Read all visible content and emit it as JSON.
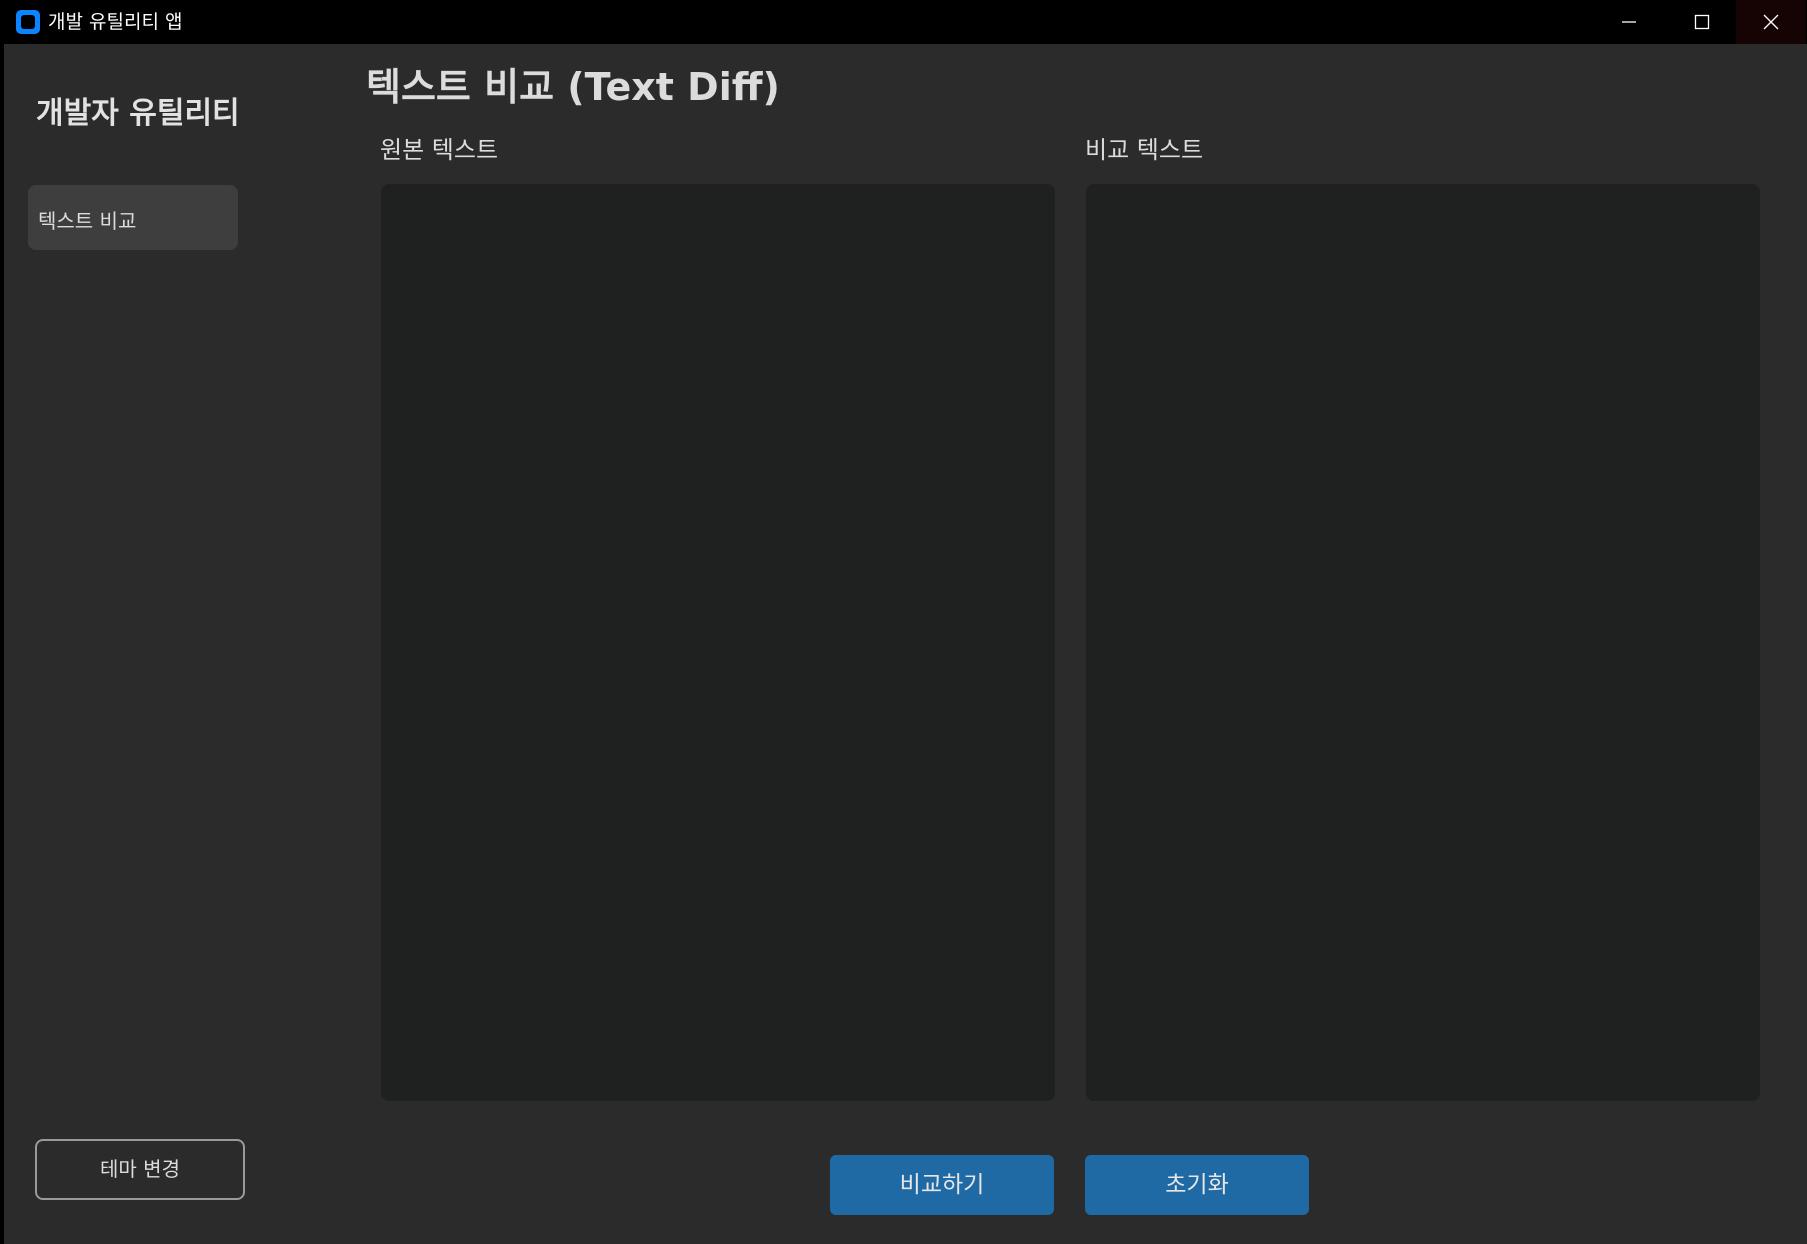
{
  "window": {
    "title": "개발 유틸리티 앱"
  },
  "sidebar": {
    "title": "개발자 유틸리티",
    "items": [
      {
        "label": "텍스트 비교"
      }
    ],
    "theme_button": "테마 변경"
  },
  "main": {
    "title": "텍스트 비교 (Text Diff)",
    "original": {
      "label": "원본 텍스트",
      "value": ""
    },
    "compare": {
      "label": "비교 텍스트",
      "value": ""
    },
    "compare_button": "비교하기",
    "reset_button": "초기화"
  },
  "colors": {
    "background": "#2b2b2b",
    "titlebar": "#000000",
    "textbox": "#1f2020",
    "nav_selected": "#3e3e3e",
    "accent_button": "#1f6aa5",
    "app_icon": "#0a84ff"
  },
  "icons": {
    "app": "app-icon",
    "minimize": "minimize-icon",
    "maximize": "maximize-icon",
    "close": "close-icon"
  }
}
